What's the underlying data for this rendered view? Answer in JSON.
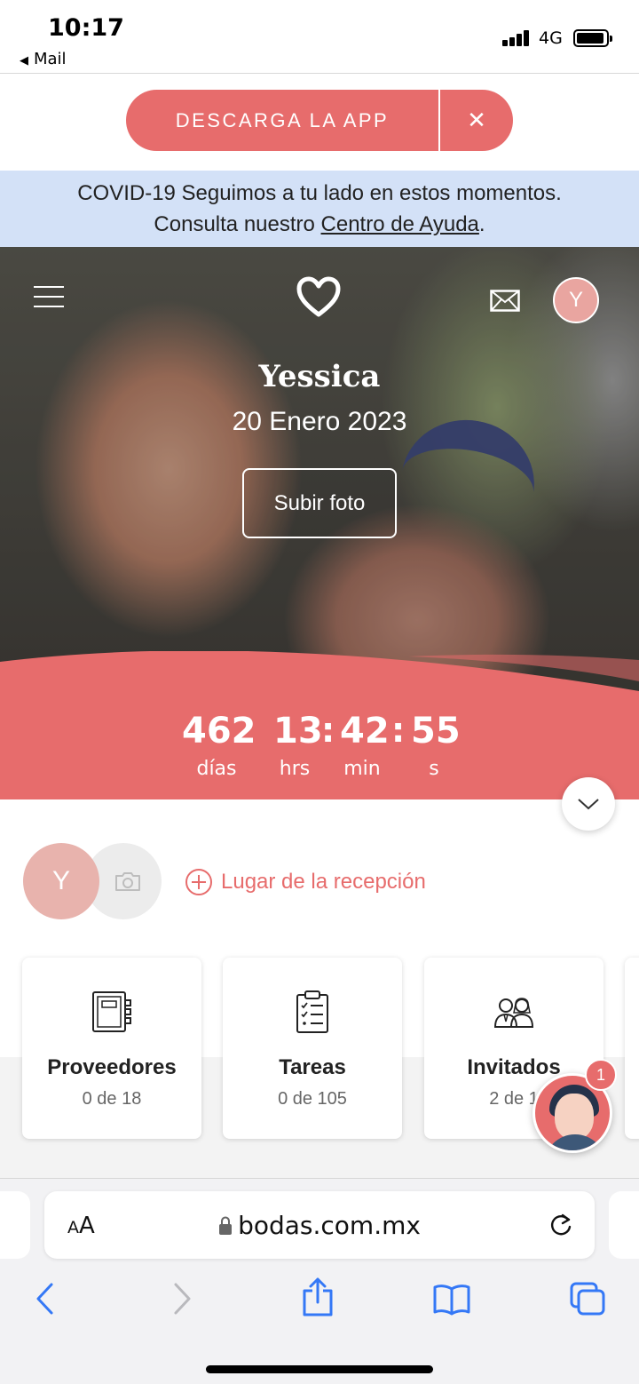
{
  "status_bar": {
    "time": "10:17",
    "back_label": "Mail",
    "network": "4G"
  },
  "app_banner": {
    "label": "DESCARGA LA APP",
    "close": "✕"
  },
  "covid_notice": {
    "line1": "COVID-19 Seguimos a tu lado en estos momentos.",
    "line2_prefix": "Consulta nuestro ",
    "link": "Centro de Ayuda",
    "line2_suffix": "."
  },
  "hero": {
    "name": "Yessica",
    "date": "20 Enero 2023",
    "upload_label": "Subir foto",
    "avatar_initial": "Y"
  },
  "countdown": {
    "days": "462",
    "days_label": "días",
    "hours": "13",
    "hours_label": "hrs",
    "minutes": "42",
    "minutes_label": "min",
    "seconds": "55",
    "seconds_label": "s",
    "separator": ":"
  },
  "profile": {
    "avatar_initial": "Y",
    "venue_link": "Lugar de la recepción"
  },
  "cards": [
    {
      "title": "Proveedores",
      "sub": "0 de 18",
      "icon": "notebook-icon"
    },
    {
      "title": "Tareas",
      "sub": "0 de 105",
      "icon": "clipboard-checklist-icon"
    },
    {
      "title": "Invitados",
      "sub": "2 de 1",
      "icon": "guests-icon"
    }
  ],
  "assistant": {
    "badge": "1"
  },
  "safari": {
    "aa_big": "A",
    "aa_small": "A",
    "url": "bodas.com.mx"
  },
  "colors": {
    "brand": "#e76c6c",
    "covid_bg": "#d3e1f7",
    "ios_blue": "#3478f6"
  }
}
